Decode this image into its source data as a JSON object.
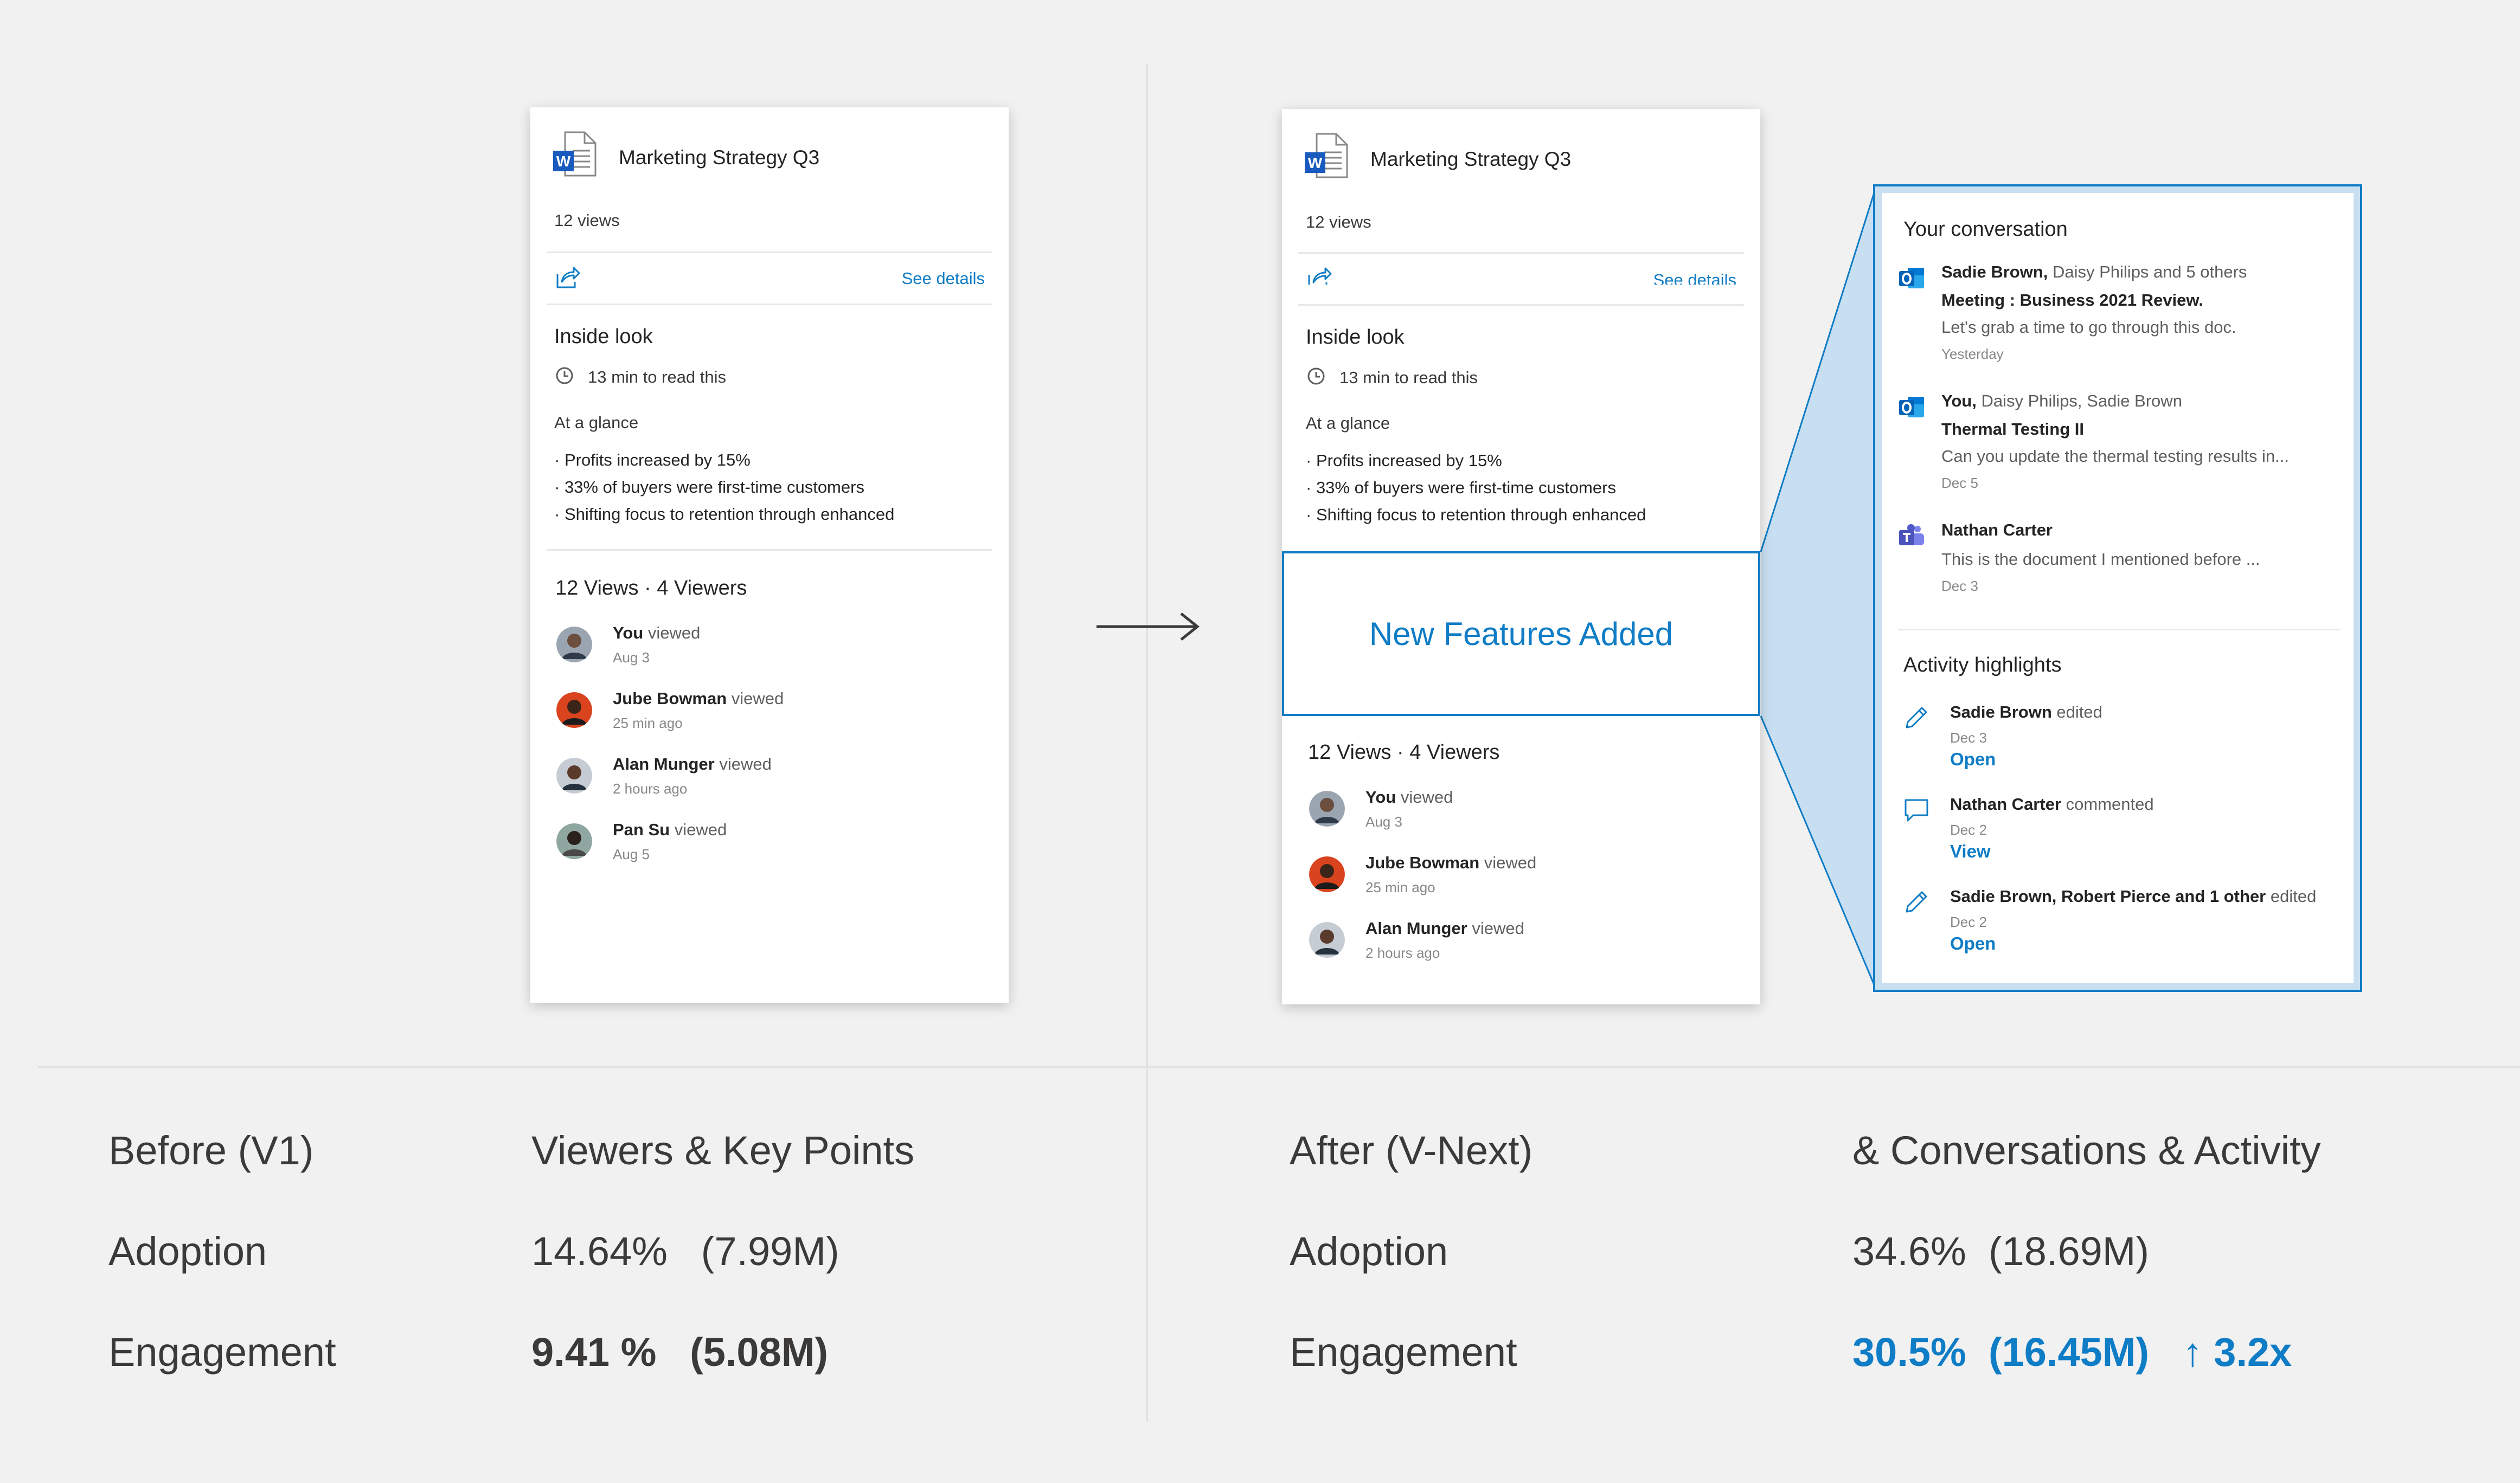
{
  "before_card": {
    "doc_title": "Marketing Strategy Q3",
    "views": "12 views",
    "see_details": "See details",
    "inside_look": "Inside look",
    "read_time": "13 min to read this",
    "at_a_glance": "At a glance",
    "bullets": [
      "Profits increased by 15%",
      "33% of buyers were first-time customers",
      "Shifting focus to retention through enhanced"
    ],
    "viewers_heading": "12 Views · 4 Viewers",
    "viewers": [
      {
        "name": "You",
        "action": "viewed",
        "time": "Aug 3"
      },
      {
        "name": "Jube Bowman",
        "action": "viewed",
        "time": "25 min ago"
      },
      {
        "name": "Alan Munger",
        "action": "viewed",
        "time": "2 hours ago"
      },
      {
        "name": "Pan Su",
        "action": "viewed",
        "time": "Aug 5"
      }
    ]
  },
  "after_card": {
    "doc_title": "Marketing Strategy Q3",
    "views": "12 views",
    "see_details": "See details",
    "inside_look": "Inside look",
    "read_time": "13 min to read this",
    "at_a_glance": "At a glance",
    "bullets": [
      "Profits increased by 15%",
      "33% of buyers were first-time customers",
      "Shifting focus to retention through enhanced"
    ],
    "new_features": "New Features Added",
    "viewers_heading": "12 Views · 4 Viewers",
    "viewers": [
      {
        "name": "You",
        "action": "viewed",
        "time": "Aug 3"
      },
      {
        "name": "Jube Bowman",
        "action": "viewed",
        "time": "25 min ago"
      },
      {
        "name": "Alan Munger",
        "action": "viewed",
        "time": "2 hours ago"
      }
    ]
  },
  "conversation_panel": {
    "heading": "Your conversation",
    "items": [
      {
        "names_bold": "Sadie Brown,",
        "names_rest": " Daisy Philips and 5 others",
        "subject": "Meeting : Business 2021 Review.",
        "preview": "Let's grab a time to go through this doc.",
        "time": "Yesterday",
        "icon": "outlook-icon"
      },
      {
        "names_bold": "You,",
        "names_rest": " Daisy Philips, Sadie Brown",
        "subject": "Thermal Testing II",
        "preview": "Can you update the thermal testing results in...",
        "time": "Dec 5",
        "icon": "outlook-icon"
      },
      {
        "names_bold": "Nathan Carter",
        "names_rest": "",
        "subject": "",
        "preview": "This is the document I mentioned before ...",
        "time": "Dec 3",
        "icon": "teams-icon"
      }
    ],
    "activity_heading": "Activity highlights",
    "activities": [
      {
        "name": "Sadie Brown",
        "action": "edited",
        "time": "Dec 3",
        "link": "Open",
        "icon": "pencil-icon"
      },
      {
        "name": "Nathan Carter",
        "action": "commented",
        "time": "Dec 2",
        "link": "View",
        "icon": "comment-icon"
      },
      {
        "name": "Sadie Brown, Robert Pierce and 1 other",
        "action": "edited",
        "time": "Dec 2",
        "link": "Open",
        "icon": "pencil-icon"
      }
    ]
  },
  "comparison": {
    "before_label": "Before (V1)",
    "before_desc": "Viewers & Key Points",
    "after_label": "After (V-Next)",
    "after_desc": "& Conversations & Activity",
    "adoption_label": "Adoption",
    "engagement_label": "Engagement",
    "before_adoption_pct": "14.64%",
    "before_adoption_abs": "(7.99M)",
    "before_engagement_pct": "9.41 %",
    "before_engagement_abs": "(5.08M)",
    "after_adoption_pct": "34.6%",
    "after_adoption_abs": "(18.69M)",
    "after_engagement_pct": "30.5%",
    "after_engagement_abs": "(16.45M)",
    "growth": "↑ 3.2x"
  },
  "colors": {
    "accent": "#0f7cc6",
    "panel_fill": "#c8dff1",
    "word_blue": "#185abd"
  }
}
